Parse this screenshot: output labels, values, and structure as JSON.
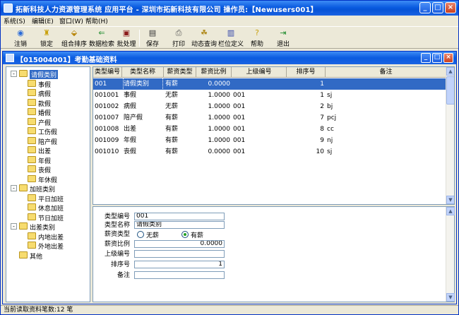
{
  "window": {
    "title": "拓新科技人力资源管理系统  应用平台  - 深圳市拓新科技有限公司    操作员:【Newusers001】"
  },
  "menu": [
    "系统(S)",
    "编辑(E)",
    "窗口(W)",
    "帮助(H)"
  ],
  "toolbar": {
    "buttons": [
      {
        "label": "注销",
        "icon": "logout-icon"
      },
      {
        "label": "锁定",
        "icon": "lock-icon"
      },
      {
        "label": "组合排序",
        "icon": "sort-icon"
      },
      {
        "label": "数据检索",
        "icon": "search-icon"
      },
      {
        "label": "批处理",
        "icon": "batch-icon"
      },
      {
        "label": "保存",
        "icon": "save-icon"
      },
      {
        "label": "打印",
        "icon": "print-icon"
      },
      {
        "label": "动态查询",
        "icon": "query-icon"
      },
      {
        "label": "栏位定义",
        "icon": "columns-icon"
      },
      {
        "label": "帮助",
        "icon": "help-icon"
      },
      {
        "label": "退出",
        "icon": "exit-icon"
      }
    ]
  },
  "inner": {
    "title": "【015004001】考勤基础资料"
  },
  "tree": [
    {
      "label": "请假类别",
      "level": 0,
      "expanded": true,
      "selected": true
    },
    {
      "label": "事假",
      "level": 1
    },
    {
      "label": "病假",
      "level": 1
    },
    {
      "label": "款假",
      "level": 1
    },
    {
      "label": "婚假",
      "level": 1
    },
    {
      "label": "产假",
      "level": 1
    },
    {
      "label": "工伤假",
      "level": 1
    },
    {
      "label": "陪产假",
      "level": 1
    },
    {
      "label": "出差",
      "level": 1
    },
    {
      "label": "年假",
      "level": 1
    },
    {
      "label": "丧假",
      "level": 1
    },
    {
      "label": "年休假",
      "level": 1
    },
    {
      "label": "加班类别",
      "level": 0,
      "expanded": true
    },
    {
      "label": "平日加班",
      "level": 1
    },
    {
      "label": "休息加班",
      "level": 1
    },
    {
      "label": "节日加班",
      "level": 1
    },
    {
      "label": "出差类别",
      "level": 0,
      "expanded": true
    },
    {
      "label": "内地出差",
      "level": 1
    },
    {
      "label": "外地出差",
      "level": 1
    },
    {
      "label": "其他",
      "level": 0
    }
  ],
  "grid": {
    "columns": [
      "类型编号",
      "类型名称",
      "薪资类型",
      "薪资比例",
      "上级编号",
      "排序号",
      "备注"
    ],
    "rows": [
      [
        "001",
        "请假类别",
        "有薪",
        "0.0000",
        "",
        "1",
        ""
      ],
      [
        "001001",
        "事假",
        "无薪",
        "1.0000",
        "001",
        "1",
        "sj"
      ],
      [
        "001002",
        "病假",
        "无薪",
        "1.0000",
        "001",
        "2",
        "bj"
      ],
      [
        "001007",
        "陪产假",
        "有薪",
        "1.0000",
        "001",
        "7",
        "pcj"
      ],
      [
        "001008",
        "出差",
        "有薪",
        "1.0000",
        "001",
        "8",
        "cc"
      ],
      [
        "001009",
        "年假",
        "有薪",
        "1.0000",
        "001",
        "9",
        "nj"
      ],
      [
        "001010",
        "丧假",
        "有薪",
        "0.0000",
        "001",
        "10",
        "sj"
      ]
    ],
    "selected_row": 0
  },
  "form": {
    "type_code_label": "类型编号",
    "type_code": "001",
    "type_name_label": "类型名称",
    "type_name": "请假类别",
    "salary_type_label": "薪资类型",
    "salary_opt_no": "无薪",
    "salary_opt_yes": "有薪",
    "salary_ratio_label": "薪资比例",
    "salary_ratio": "0.0000",
    "parent_code_label": "上级编号",
    "parent_code": "",
    "sort_label": "排序号",
    "sort": "1",
    "remark_label": "备注",
    "remark": ""
  },
  "status": {
    "text": "当前读取资料笔数:12 笔"
  }
}
